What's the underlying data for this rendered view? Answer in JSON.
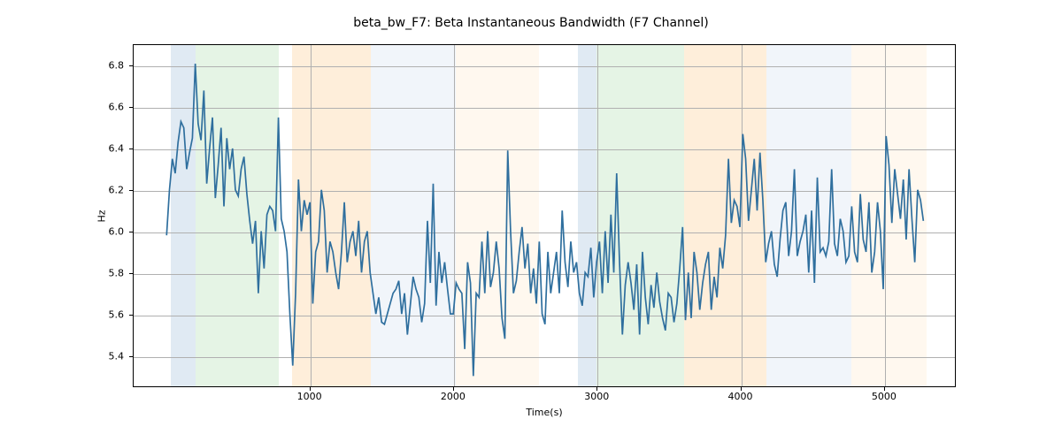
{
  "chart_data": {
    "type": "line",
    "title": "beta_bw_F7: Beta Instantaneous Bandwidth (F7 Channel)",
    "xlabel": "Time(s)",
    "ylabel": "Hz",
    "xlim": [
      -230,
      5500
    ],
    "ylim": [
      5.25,
      6.9
    ],
    "xticks": [
      1000,
      2000,
      3000,
      4000,
      5000
    ],
    "yticks": [
      5.4,
      5.6,
      5.8,
      6.0,
      6.2,
      6.4,
      6.6,
      6.8
    ],
    "bands": [
      {
        "x0": 30,
        "x1": 200,
        "color": "#a7c4de"
      },
      {
        "x0": 200,
        "x1": 780,
        "color": "#b4dfb4"
      },
      {
        "x0": 870,
        "x1": 1420,
        "color": "#fdcd94"
      },
      {
        "x0": 1420,
        "x1": 2010,
        "color": "#d7e3f0"
      },
      {
        "x0": 2010,
        "x1": 2590,
        "color": "#feead2"
      },
      {
        "x0": 2860,
        "x1": 2990,
        "color": "#a7c4de"
      },
      {
        "x0": 2990,
        "x1": 3605,
        "color": "#b4dfb4"
      },
      {
        "x0": 3605,
        "x1": 4175,
        "color": "#fdcd94"
      },
      {
        "x0": 4175,
        "x1": 4765,
        "color": "#d7e3f0"
      },
      {
        "x0": 4765,
        "x1": 5290,
        "color": "#feead2"
      }
    ],
    "series": [
      {
        "name": "beta_bw_F7",
        "color": "#2f6f9e",
        "x": [
          0,
          20,
          40,
          60,
          80,
          100,
          120,
          140,
          160,
          180,
          200,
          220,
          240,
          260,
          280,
          300,
          320,
          340,
          360,
          380,
          400,
          420,
          440,
          460,
          480,
          500,
          520,
          540,
          560,
          580,
          600,
          620,
          640,
          660,
          680,
          700,
          720,
          740,
          760,
          780,
          800,
          820,
          840,
          860,
          880,
          900,
          920,
          940,
          960,
          980,
          1000,
          1020,
          1040,
          1060,
          1080,
          1100,
          1120,
          1140,
          1160,
          1180,
          1200,
          1220,
          1240,
          1260,
          1280,
          1300,
          1320,
          1340,
          1360,
          1380,
          1400,
          1420,
          1440,
          1460,
          1480,
          1500,
          1520,
          1540,
          1560,
          1580,
          1600,
          1620,
          1640,
          1660,
          1680,
          1700,
          1720,
          1740,
          1760,
          1780,
          1800,
          1820,
          1840,
          1860,
          1880,
          1900,
          1920,
          1940,
          1960,
          1980,
          2000,
          2020,
          2040,
          2060,
          2080,
          2100,
          2120,
          2140,
          2160,
          2180,
          2200,
          2220,
          2240,
          2260,
          2280,
          2300,
          2320,
          2340,
          2360,
          2380,
          2400,
          2420,
          2440,
          2460,
          2480,
          2500,
          2520,
          2540,
          2560,
          2580,
          2600,
          2620,
          2640,
          2660,
          2680,
          2700,
          2720,
          2740,
          2760,
          2780,
          2800,
          2820,
          2840,
          2860,
          2880,
          2900,
          2920,
          2940,
          2960,
          2980,
          3000,
          3020,
          3040,
          3060,
          3080,
          3100,
          3120,
          3140,
          3160,
          3180,
          3200,
          3220,
          3240,
          3260,
          3280,
          3300,
          3320,
          3340,
          3360,
          3380,
          3400,
          3420,
          3440,
          3460,
          3480,
          3500,
          3520,
          3540,
          3560,
          3580,
          3600,
          3620,
          3640,
          3660,
          3680,
          3700,
          3720,
          3740,
          3760,
          3780,
          3800,
          3820,
          3840,
          3860,
          3880,
          3900,
          3920,
          3940,
          3960,
          3980,
          4000,
          4020,
          4040,
          4060,
          4080,
          4100,
          4120,
          4140,
          4160,
          4180,
          4200,
          4220,
          4240,
          4260,
          4280,
          4300,
          4320,
          4340,
          4360,
          4380,
          4400,
          4420,
          4440,
          4460,
          4480,
          4500,
          4520,
          4540,
          4560,
          4580,
          4600,
          4620,
          4640,
          4660,
          4680,
          4700,
          4720,
          4740,
          4760,
          4780,
          4800,
          4820,
          4840,
          4860,
          4880,
          4900,
          4920,
          4940,
          4960,
          4980,
          5000,
          5020,
          5040,
          5060,
          5080,
          5100,
          5120,
          5140,
          5160,
          5180,
          5200,
          5220,
          5240,
          5260,
          5280
        ],
        "y": [
          5.98,
          6.2,
          6.35,
          6.28,
          6.43,
          6.53,
          6.5,
          6.3,
          6.38,
          6.45,
          6.81,
          6.52,
          6.44,
          6.68,
          6.23,
          6.4,
          6.55,
          6.16,
          6.32,
          6.5,
          6.12,
          6.45,
          6.3,
          6.4,
          6.2,
          6.17,
          6.3,
          6.36,
          6.18,
          6.05,
          5.94,
          6.05,
          5.7,
          6.0,
          5.82,
          6.08,
          6.12,
          6.1,
          6.0,
          6.55,
          6.06,
          6.0,
          5.9,
          5.6,
          5.35,
          5.7,
          6.25,
          6.0,
          6.15,
          6.08,
          6.14,
          5.65,
          5.9,
          5.95,
          6.2,
          6.1,
          5.8,
          5.95,
          5.9,
          5.8,
          5.72,
          5.9,
          6.14,
          5.85,
          5.95,
          6.0,
          5.88,
          6.05,
          5.8,
          5.95,
          6.0,
          5.8,
          5.7,
          5.6,
          5.68,
          5.56,
          5.55,
          5.6,
          5.65,
          5.7,
          5.72,
          5.76,
          5.6,
          5.7,
          5.5,
          5.64,
          5.78,
          5.72,
          5.68,
          5.56,
          5.65,
          6.05,
          5.75,
          6.23,
          5.64,
          5.9,
          5.75,
          5.85,
          5.72,
          5.6,
          5.6,
          5.75,
          5.72,
          5.7,
          5.43,
          5.85,
          5.75,
          5.3,
          5.7,
          5.68,
          5.95,
          5.7,
          6.0,
          5.73,
          5.8,
          5.95,
          5.82,
          5.58,
          5.48,
          6.39,
          6.0,
          5.7,
          5.76,
          5.9,
          6.02,
          5.82,
          5.94,
          5.7,
          5.82,
          5.65,
          5.95,
          5.6,
          5.55,
          5.9,
          5.7,
          5.8,
          5.9,
          5.7,
          6.1,
          5.85,
          5.73,
          5.95,
          5.8,
          5.85,
          5.7,
          5.64,
          5.8,
          5.78,
          5.92,
          5.68,
          5.85,
          5.95,
          5.7,
          6.0,
          5.75,
          6.08,
          5.8,
          6.28,
          5.85,
          5.5,
          5.74,
          5.85,
          5.75,
          5.62,
          5.84,
          5.5,
          5.9,
          5.68,
          5.55,
          5.74,
          5.63,
          5.8,
          5.66,
          5.58,
          5.52,
          5.7,
          5.68,
          5.56,
          5.65,
          5.82,
          6.02,
          5.57,
          5.8,
          5.58,
          5.9,
          5.8,
          5.62,
          5.75,
          5.84,
          5.9,
          5.62,
          5.78,
          5.68,
          5.92,
          5.82,
          5.98,
          6.35,
          6.04,
          6.15,
          6.12,
          6.02,
          6.47,
          6.35,
          6.05,
          6.2,
          6.35,
          6.1,
          6.38,
          6.15,
          5.85,
          5.94,
          6.0,
          5.84,
          5.78,
          5.96,
          6.1,
          6.14,
          5.88,
          6.0,
          6.3,
          5.88,
          5.95,
          6.0,
          6.08,
          5.8,
          6.1,
          5.75,
          6.26,
          5.9,
          5.92,
          5.88,
          5.95,
          6.3,
          5.94,
          5.88,
          6.06,
          6.0,
          5.85,
          5.88,
          6.12,
          5.9,
          5.85,
          6.18,
          5.96,
          5.9,
          6.14,
          5.8,
          5.9,
          6.14,
          6.0,
          5.72,
          6.46,
          6.32,
          6.04,
          6.3,
          6.18,
          6.06,
          6.25,
          5.96,
          6.3,
          6.06,
          5.85,
          6.2,
          6.15,
          6.05,
          6.08
        ]
      }
    ]
  }
}
